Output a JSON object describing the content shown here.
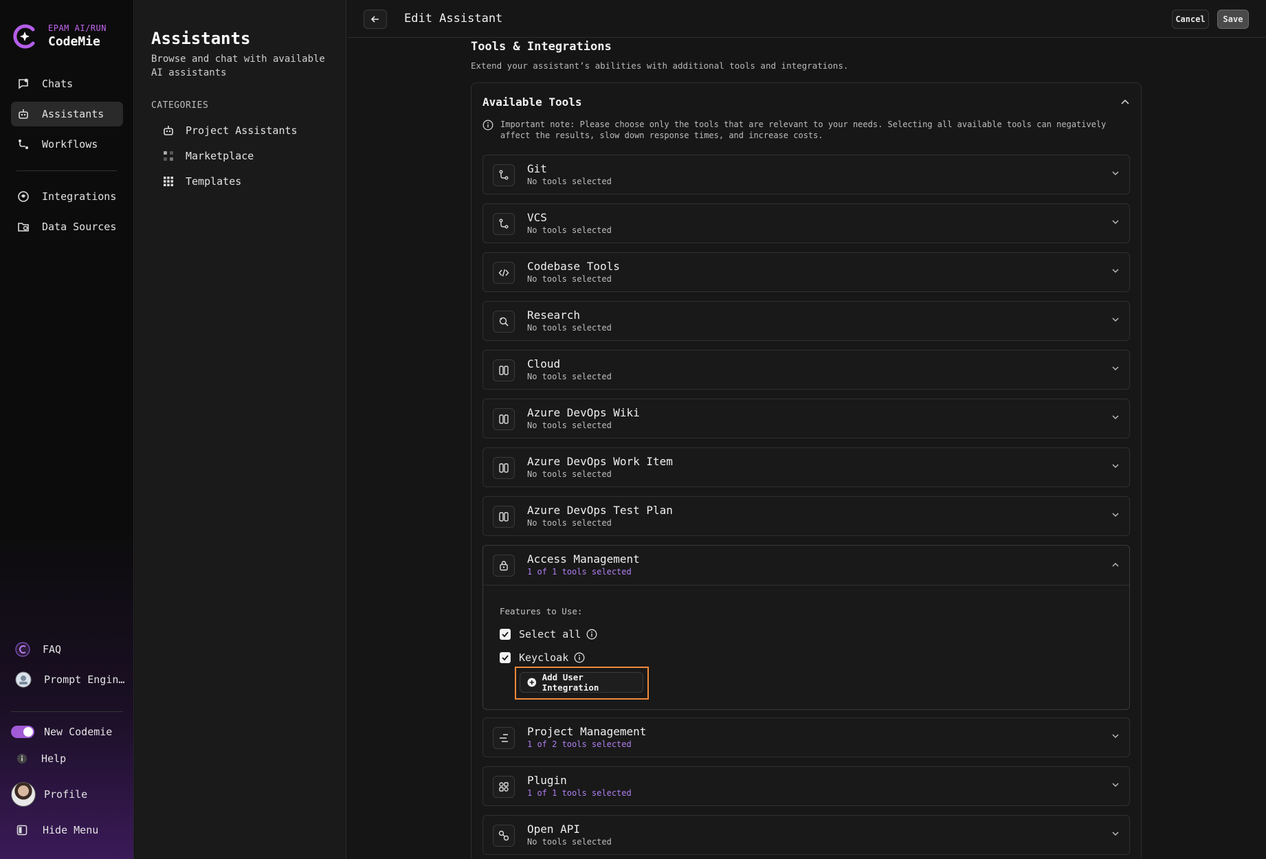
{
  "brand": {
    "top": "EPAM AI/RUN",
    "name": "CodeMie"
  },
  "sidebar": {
    "nav": [
      {
        "label": "Chats",
        "icon": "chat-icon"
      },
      {
        "label": "Assistants",
        "icon": "robot-icon",
        "active": true
      },
      {
        "label": "Workflows",
        "icon": "workflow-icon"
      },
      {
        "label": "Integrations",
        "icon": "integrations-icon"
      },
      {
        "label": "Data Sources",
        "icon": "data-sources-icon"
      }
    ],
    "bottom": {
      "faq": "FAQ",
      "prompt": "Prompt Engin…",
      "new_codemie": "New Codemie",
      "help": "Help",
      "profile": "Profile",
      "hide_menu": "Hide Menu"
    }
  },
  "categories": {
    "title": "Assistants",
    "subtitle": "Browse and chat with available AI assistants",
    "heading": "CATEGORIES",
    "items": [
      "Project Assistants",
      "Marketplace",
      "Templates"
    ]
  },
  "topbar": {
    "title": "Edit Assistant",
    "cancel": "Cancel",
    "save": "Save"
  },
  "section": {
    "title": "Tools & Integrations",
    "subtitle": "Extend your assistant’s abilities with additional tools and integrations."
  },
  "tools": {
    "header": "Available Tools",
    "note": "Important note: Please choose only the tools that are relevant to your needs. Selecting all available tools can negatively affect the results, slow down response times, and increase costs.",
    "rows": [
      {
        "name": "Git",
        "status": "No tools selected",
        "icon": "git-branch-icon"
      },
      {
        "name": "VCS",
        "status": "No tools selected",
        "icon": "git-branch-icon"
      },
      {
        "name": "Codebase Tools",
        "status": "No tools selected",
        "icon": "code-icon"
      },
      {
        "name": "Research",
        "status": "No tools selected",
        "icon": "search-icon"
      },
      {
        "name": "Cloud",
        "status": "No tools selected",
        "icon": "columns-icon"
      },
      {
        "name": "Azure DevOps Wiki",
        "status": "No tools selected",
        "icon": "columns-icon"
      },
      {
        "name": "Azure DevOps Work Item",
        "status": "No tools selected",
        "icon": "columns-icon"
      },
      {
        "name": "Azure DevOps Test Plan",
        "status": "No tools selected",
        "icon": "columns-icon"
      }
    ],
    "access": {
      "name": "Access Management",
      "status": "1 of 1 tools selected",
      "features_label": "Features to Use:",
      "select_all": "Select all",
      "keycloak": "Keycloak",
      "add_integration": "Add User Integration"
    },
    "rows_after": [
      {
        "name": "Project Management",
        "status": "1 of 2 tools selected",
        "icon": "list-icon"
      },
      {
        "name": "Plugin",
        "status": "1 of 1 tools selected",
        "icon": "plugin-icon"
      },
      {
        "name": "Open API",
        "status": "No tools selected",
        "icon": "api-icon"
      }
    ]
  },
  "colors": {
    "accent": "#b07ef0",
    "highlight": "#f08a3c",
    "toggle": "#a25ad6"
  }
}
